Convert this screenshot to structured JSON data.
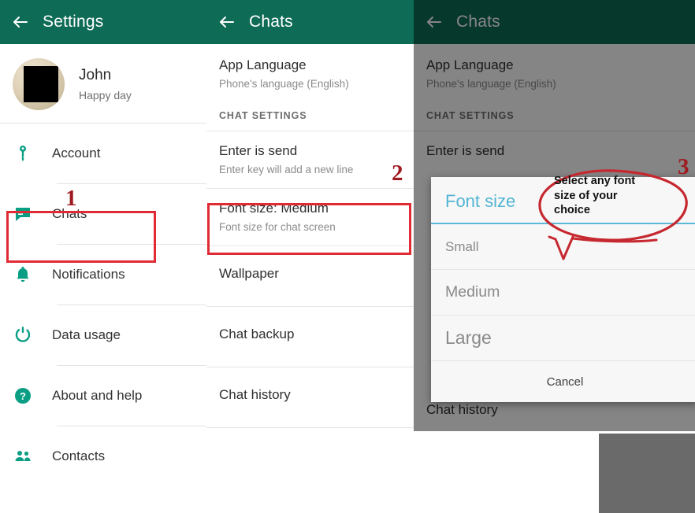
{
  "settings_panel": {
    "appbar": {
      "back_icon": "back-arrow-icon",
      "title": "Settings"
    },
    "profile": {
      "name": "John",
      "status": "Happy day",
      "avatar": "user-avatar"
    },
    "items": [
      {
        "label": "Account",
        "icon": "key-icon"
      },
      {
        "label": "Chats",
        "icon": "chat-bubble-icon"
      },
      {
        "label": "Notifications",
        "icon": "bell-icon"
      },
      {
        "label": "Data usage",
        "icon": "data-usage-icon"
      },
      {
        "label": "About and help",
        "icon": "question-mark-icon"
      },
      {
        "label": "Contacts",
        "icon": "contacts-icon"
      }
    ]
  },
  "chats_panel": {
    "appbar": {
      "back_icon": "back-arrow-icon",
      "title": "Chats"
    },
    "app_language": {
      "title": "App Language",
      "subtitle": "Phone's language (English)"
    },
    "section_header": "CHAT SETTINGS",
    "items": [
      {
        "title": "Enter is send",
        "subtitle": "Enter key will add a new line"
      },
      {
        "title": "Font size: Medium",
        "subtitle": "Font size for chat screen"
      },
      {
        "title": "Wallpaper",
        "subtitle": ""
      },
      {
        "title": "Chat backup",
        "subtitle": ""
      },
      {
        "title": "Chat history",
        "subtitle": ""
      }
    ]
  },
  "dialog_panel": {
    "appbar": {
      "back_icon": "back-arrow-icon",
      "title": "Chats"
    },
    "app_language": {
      "title": "App Language",
      "subtitle": "Phone's language (English)"
    },
    "section_header": "CHAT SETTINGS",
    "behind_item": "Enter is send",
    "behind_item_bottom": "Chat history",
    "dialog": {
      "title": "Font size",
      "options": [
        "Small",
        "Medium",
        "Large"
      ],
      "cancel_label": "Cancel"
    }
  },
  "annotations": {
    "marker_1": "1",
    "marker_2": "2",
    "marker_3": "3",
    "callout_text": "Select any font size of your choice",
    "color": "#9e1b20",
    "box_color": "#e02b35"
  },
  "colors": {
    "appbar_green": "#0e6b55",
    "accent_teal": "#0a9e84",
    "dialog_blue": "#53b5d4"
  }
}
